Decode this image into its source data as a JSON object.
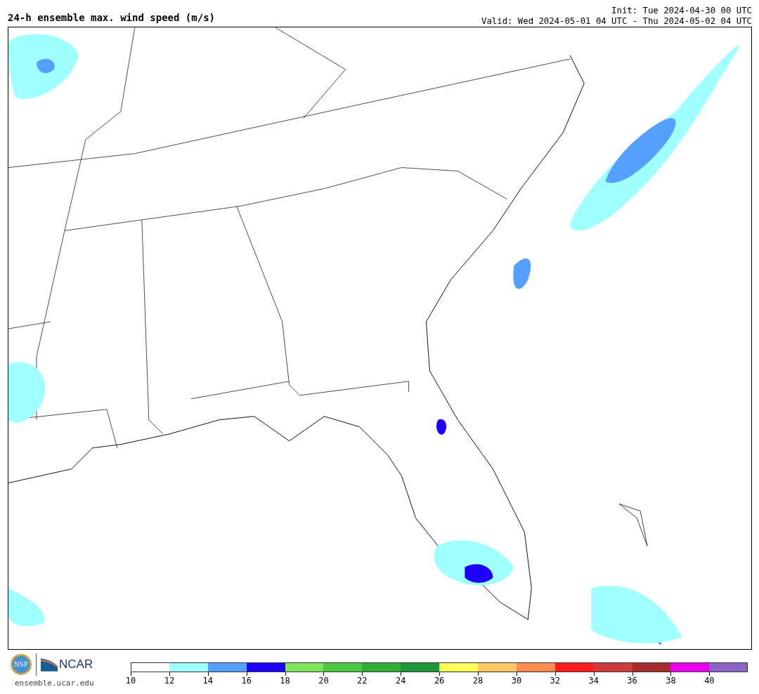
{
  "title": "24-h ensemble max. wind speed (m/s)",
  "init": "Init: Tue 2024-04-30 00 UTC",
  "valid": "Valid: Wed 2024-05-01 04 UTC - Thu 2024-05-02 04 UTC",
  "logos": {
    "ncar": "NCAR",
    "nsf": "NSF",
    "url": "ensemble.ucar.edu"
  },
  "colorbar": [
    {
      "color": "#ffffff",
      "label": "10"
    },
    {
      "color": "#a0ffff",
      "label": "12"
    },
    {
      "color": "#55a0ff",
      "label": "14"
    },
    {
      "color": "#1e00ff",
      "label": "16"
    },
    {
      "color": "#7de65a",
      "label": "18"
    },
    {
      "color": "#4bc840",
      "label": "20"
    },
    {
      "color": "#2ead37",
      "label": "22"
    },
    {
      "color": "#1f963c",
      "label": "24"
    },
    {
      "color": "#ffff5a",
      "label": "26"
    },
    {
      "color": "#ffc864",
      "label": "28"
    },
    {
      "color": "#ff8c50",
      "label": "30"
    },
    {
      "color": "#ff1e1e",
      "label": "32"
    },
    {
      "color": "#cd3c3c",
      "label": "34"
    },
    {
      "color": "#a52d2d",
      "label": "36"
    },
    {
      "color": "#eb00eb",
      "label": "38"
    },
    {
      "color": "#8c64c8",
      "label": "40"
    }
  ]
}
